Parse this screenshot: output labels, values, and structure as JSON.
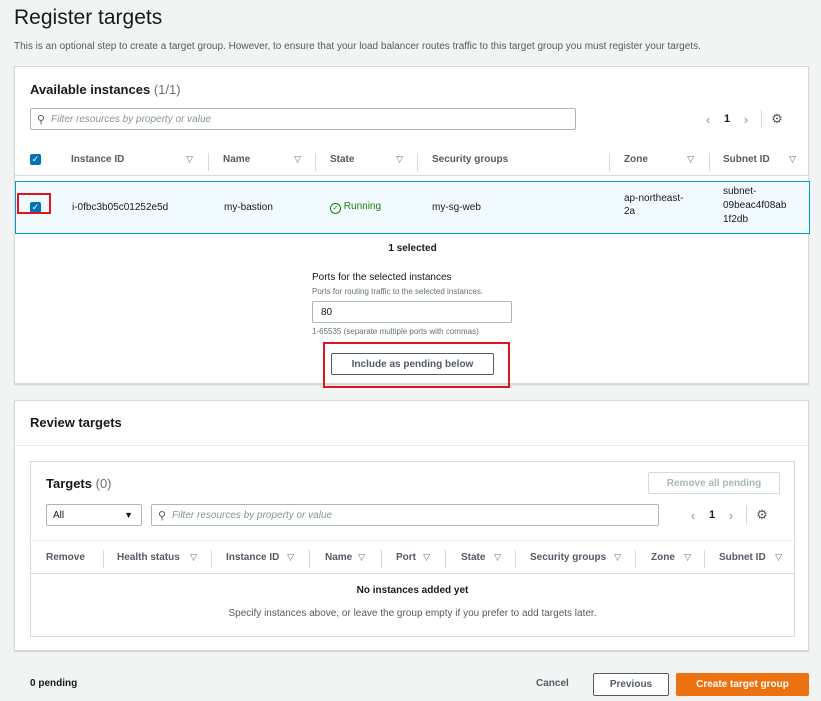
{
  "page": {
    "title": "Register targets",
    "description": "This is an optional step to create a target group. However, to ensure that your load balancer routes traffic to this target group you must register your targets."
  },
  "available": {
    "title": "Available instances",
    "count": "(1/1)",
    "filter_placeholder": "Filter resources by property or value",
    "page": "1",
    "columns": [
      "Instance ID",
      "Name",
      "State",
      "Security groups",
      "Zone",
      "Subnet ID"
    ],
    "rows": [
      {
        "instance_id": "i-0fbc3b05c01252e5d",
        "name": "my-bastion",
        "state": "Running",
        "security_groups": "my-sg-web",
        "zone_line1": "ap-northeast-",
        "zone_line2": "2a",
        "subnet_line1": "subnet-",
        "subnet_line2": "09beac4f08ab",
        "subnet_line3": "1f2db",
        "selected": true
      }
    ],
    "selected_text": "1 selected",
    "ports_label": "Ports for the selected instances",
    "ports_desc": "Ports for routing traffic to the selected instances.",
    "ports_value": "80",
    "ports_hint": "1-65535 (separate multiple ports with commas)",
    "include_button": "Include as pending below"
  },
  "review": {
    "title": "Review targets",
    "targets_title": "Targets",
    "targets_count": "(0)",
    "remove_all_button": "Remove all pending",
    "select_value": "All",
    "filter_placeholder": "Filter resources by property or value",
    "page": "1",
    "columns": [
      "Remove",
      "Health status",
      "Instance ID",
      "Name",
      "Port",
      "State",
      "Security groups",
      "Zone",
      "Subnet ID"
    ],
    "empty_title": "No instances added yet",
    "empty_desc": "Specify instances above, or leave the group empty if you prefer to add targets later."
  },
  "footer": {
    "pending": "0 pending",
    "cancel": "Cancel",
    "previous": "Previous",
    "create": "Create target group"
  },
  "colors": {
    "accent": "#0073bb",
    "primary_button": "#ec7211",
    "running": "#1d8102",
    "highlight": "#e1141e"
  }
}
